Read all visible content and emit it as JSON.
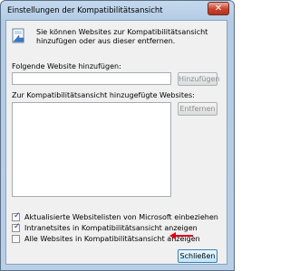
{
  "window": {
    "title": "Einstellungen der Kompatibilitätsansicht",
    "close_glyph": "✕"
  },
  "info": {
    "text": "Sie können Websites zur Kompatibilitätsansicht hinzufügen oder aus dieser entfernen."
  },
  "add_section": {
    "label": "Folgende Website hinzufügen:",
    "input_value": "",
    "add_button": "Hinzufügen"
  },
  "list_section": {
    "label": "Zur Kompatibilitätsansicht hinzugefügte Websites:",
    "remove_button": "Entfernen",
    "items": []
  },
  "options": [
    {
      "label": "Aktualisierte Websitelisten von Microsoft einbeziehen",
      "checked": true
    },
    {
      "label": "Intranetsites in Kompatibilitätsansicht anzeigen",
      "checked": true
    },
    {
      "label": "Alle Websites in Kompatibilitätsansicht anzeigen",
      "checked": false
    }
  ],
  "footer": {
    "close_button": "Schließen"
  },
  "colors": {
    "annotation_arrow": "#e0001b",
    "titlebar": "#b9cfe6",
    "close_button": "#c7412a"
  }
}
